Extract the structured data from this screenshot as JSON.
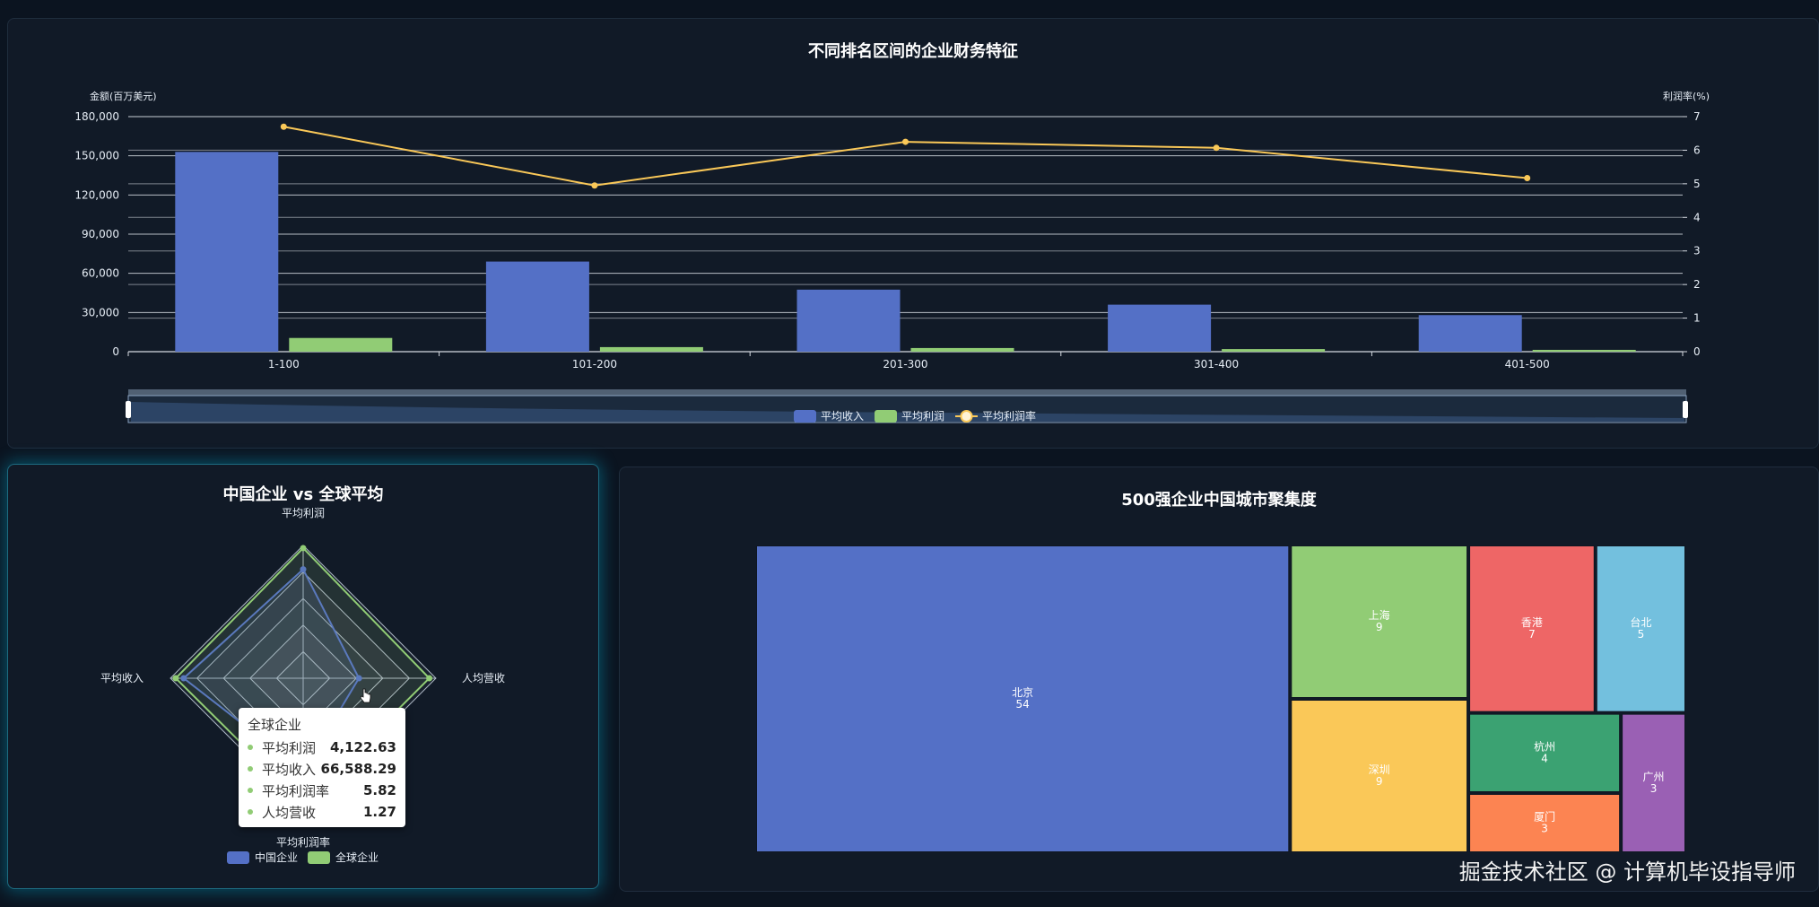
{
  "bar_panel": {
    "title": "不同排名区间的企业财务特征",
    "legend": [
      "平均收入",
      "平均利润",
      "平均利润率"
    ]
  },
  "radar_panel": {
    "title": "中国企业 vs 全球平均",
    "legend": [
      "中国企业",
      "全球企业"
    ]
  },
  "treemap_panel": {
    "title": "500强企业中国城市聚集度"
  },
  "tooltip": {
    "title": "全球企业",
    "rows": [
      {
        "label": "平均利润",
        "value": "4,122.63"
      },
      {
        "label": "平均收入",
        "value": "66,588.29"
      },
      {
        "label": "平均利润率",
        "value": "5.82"
      },
      {
        "label": "人均营收",
        "value": "1.27"
      }
    ]
  },
  "watermark": "掘金技术社区 @ 计算机毕设指导师",
  "colors": {
    "blue": "#5470c6",
    "green": "#91cc75",
    "yellow": "#fac858",
    "red": "#ee6666",
    "lightblue": "#73c0de",
    "teal": "#3ba272",
    "orange": "#fc8452",
    "purple": "#9a60b4"
  },
  "chart_data": [
    {
      "type": "bar",
      "title": "不同排名区间的企业财务特征",
      "categories": [
        "1-100",
        "101-200",
        "201-300",
        "301-400",
        "401-500"
      ],
      "ylabel": "金额(百万美元)",
      "ylim": [
        0,
        180000
      ],
      "yticks": [
        "0",
        "30,000",
        "60,000",
        "90,000",
        "120,000",
        "150,000",
        "180,000"
      ],
      "y2label": "利润率(%)",
      "y2lim": [
        0,
        7
      ],
      "y2ticks": [
        "0",
        "1",
        "2",
        "3",
        "4",
        "5",
        "6",
        "7"
      ],
      "series": [
        {
          "name": "平均收入",
          "kind": "bar",
          "axis": "left",
          "values": [
            153000,
            69000,
            47500,
            36000,
            28000
          ]
        },
        {
          "name": "平均利润",
          "kind": "bar",
          "axis": "left",
          "values": [
            10500,
            3500,
            2800,
            2000,
            1400
          ]
        },
        {
          "name": "平均利润率",
          "kind": "line",
          "axis": "right",
          "values": [
            6.7,
            4.95,
            6.25,
            6.07,
            5.17
          ]
        }
      ],
      "grid": true,
      "legend_position": "bottom-center"
    },
    {
      "type": "radar",
      "title": "中国企业 vs 全球平均",
      "indicators": [
        "平均利润",
        "人均营收",
        "平均利润率",
        "平均收入"
      ],
      "series": [
        {
          "name": "中国企业",
          "values": [
            0.82,
            0.42,
            0.7,
            0.9
          ]
        },
        {
          "name": "全球企业",
          "values": [
            0.98,
            0.95,
            0.95,
            0.96
          ]
        }
      ],
      "legend_position": "bottom-center"
    },
    {
      "type": "treemap",
      "title": "500强企业中国城市聚集度",
      "items": [
        {
          "name": "北京",
          "value": 54,
          "color": "#5470c6"
        },
        {
          "name": "上海",
          "value": 9,
          "color": "#91cc75"
        },
        {
          "name": "深圳",
          "value": 9,
          "color": "#fac858"
        },
        {
          "name": "香港",
          "value": 7,
          "color": "#ee6666"
        },
        {
          "name": "台北",
          "value": 5,
          "color": "#73c0de"
        },
        {
          "name": "杭州",
          "value": 4,
          "color": "#3ba272"
        },
        {
          "name": "厦门",
          "value": 3,
          "color": "#fc8452"
        },
        {
          "name": "广州",
          "value": 3,
          "color": "#9a60b4"
        }
      ]
    }
  ]
}
